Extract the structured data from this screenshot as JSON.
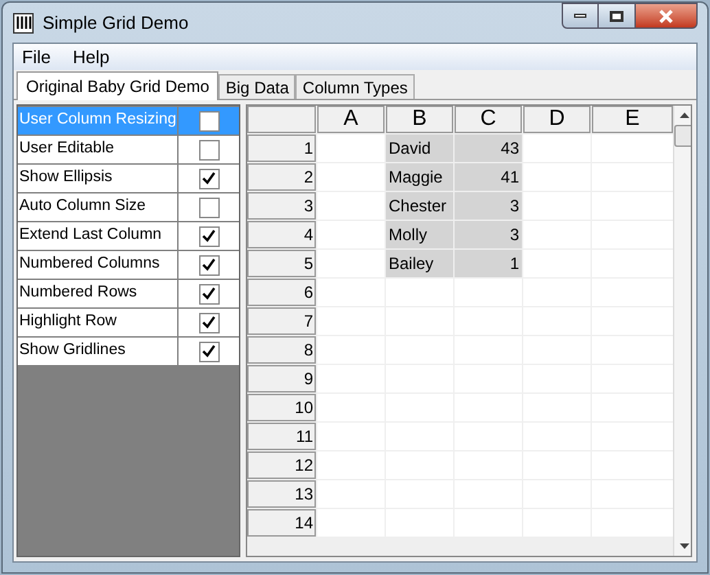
{
  "window": {
    "title": "Simple Grid Demo"
  },
  "menu": [
    {
      "label": "File"
    },
    {
      "label": "Help"
    }
  ],
  "tabs": [
    {
      "label": "Original Baby Grid Demo",
      "selected": true
    },
    {
      "label": "Big Data",
      "selected": false
    },
    {
      "label": "Column Types",
      "selected": false
    }
  ],
  "options": [
    {
      "label": "User Column Resizing",
      "checked": false,
      "selected": true
    },
    {
      "label": "User Editable",
      "checked": false,
      "selected": false
    },
    {
      "label": "Show Ellipsis",
      "checked": true,
      "selected": false
    },
    {
      "label": "Auto Column Size",
      "checked": false,
      "selected": false
    },
    {
      "label": "Extend Last Column",
      "checked": true,
      "selected": false
    },
    {
      "label": "Numbered Columns",
      "checked": true,
      "selected": false
    },
    {
      "label": "Numbered Rows",
      "checked": true,
      "selected": false
    },
    {
      "label": "Highlight Row",
      "checked": true,
      "selected": false
    },
    {
      "label": "Show Gridlines",
      "checked": true,
      "selected": false
    }
  ],
  "grid": {
    "columns": [
      "A",
      "B",
      "C",
      "D",
      "E"
    ],
    "rows": [
      {
        "number": "1",
        "cells": {
          "B": "David",
          "C": "43"
        }
      },
      {
        "number": "2",
        "cells": {
          "B": "Maggie",
          "C": "41"
        }
      },
      {
        "number": "3",
        "cells": {
          "B": "Chester",
          "C": "3"
        }
      },
      {
        "number": "4",
        "cells": {
          "B": "Molly",
          "C": "3"
        }
      },
      {
        "number": "5",
        "cells": {
          "B": "Bailey",
          "C": "1"
        }
      },
      {
        "number": "6"
      },
      {
        "number": "7"
      },
      {
        "number": "8"
      },
      {
        "number": "9"
      },
      {
        "number": "10"
      },
      {
        "number": "11"
      },
      {
        "number": "12"
      },
      {
        "number": "13"
      },
      {
        "number": "14"
      }
    ]
  }
}
